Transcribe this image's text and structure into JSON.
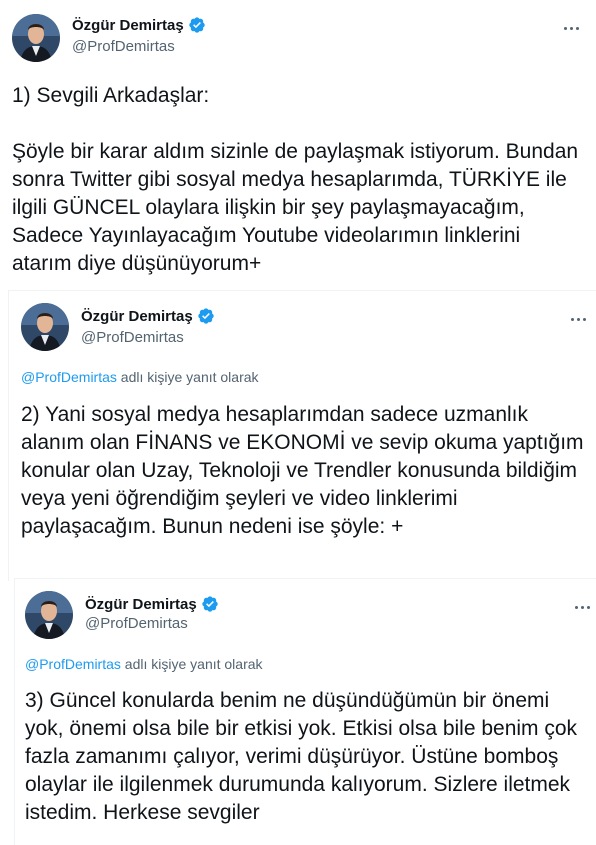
{
  "tweets": [
    {
      "author": {
        "name": "Özgür Demirtaş",
        "handle": "@ProfDemirtas"
      },
      "reply_mention": "",
      "reply_suffix": "",
      "text": "1) Sevgili Arkadaşlar:\n\nŞöyle bir karar aldım sizinle de paylaşmak istiyorum. Bundan sonra Twitter gibi sosyal medya hesaplarımda, TÜRKİYE ile ilgili GÜNCEL olaylara ilişkin bir şey paylaşmayacağım, Sadece Yayınlayacağım Youtube videolarımın linklerini atarım diye düşünüyorum+"
    },
    {
      "author": {
        "name": "Özgür Demirtaş",
        "handle": "@ProfDemirtas"
      },
      "reply_mention": "@ProfDemirtas",
      "reply_suffix": " adlı kişiye yanıt olarak",
      "text": "2) Yani sosyal medya hesaplarımdan sadece uzmanlık alanım olan FİNANS ve EKONOMİ ve sevip okuma yaptığım konular olan Uzay, Teknoloji ve Trendler konusunda bildiğim veya yeni öğrendiğim şeyleri ve video linklerimi paylaşacağım. Bunun nedeni ise şöyle: +"
    },
    {
      "author": {
        "name": "Özgür Demirtaş",
        "handle": "@ProfDemirtas"
      },
      "reply_mention": "@ProfDemirtas",
      "reply_suffix": " adlı kişiye yanıt olarak",
      "text": "3) Güncel konularda benim ne düşündüğümün bir önemi yok, önemi olsa bile bir etkisi yok. Etkisi olsa bile benim çok fazla zamanımı çalıyor, verimi düşürüyor. Üstüne bomboş olaylar ile ilgilenmek durumunda kalıyorum. Sizlere iletmek istedim. Herkese sevgiler"
    }
  ],
  "colors": {
    "verified": "#1d9bf0",
    "link": "#1d9bf0",
    "secondary_text": "#536471"
  },
  "icons": {
    "verified": "verified-badge-icon",
    "more": "more-options-icon"
  }
}
